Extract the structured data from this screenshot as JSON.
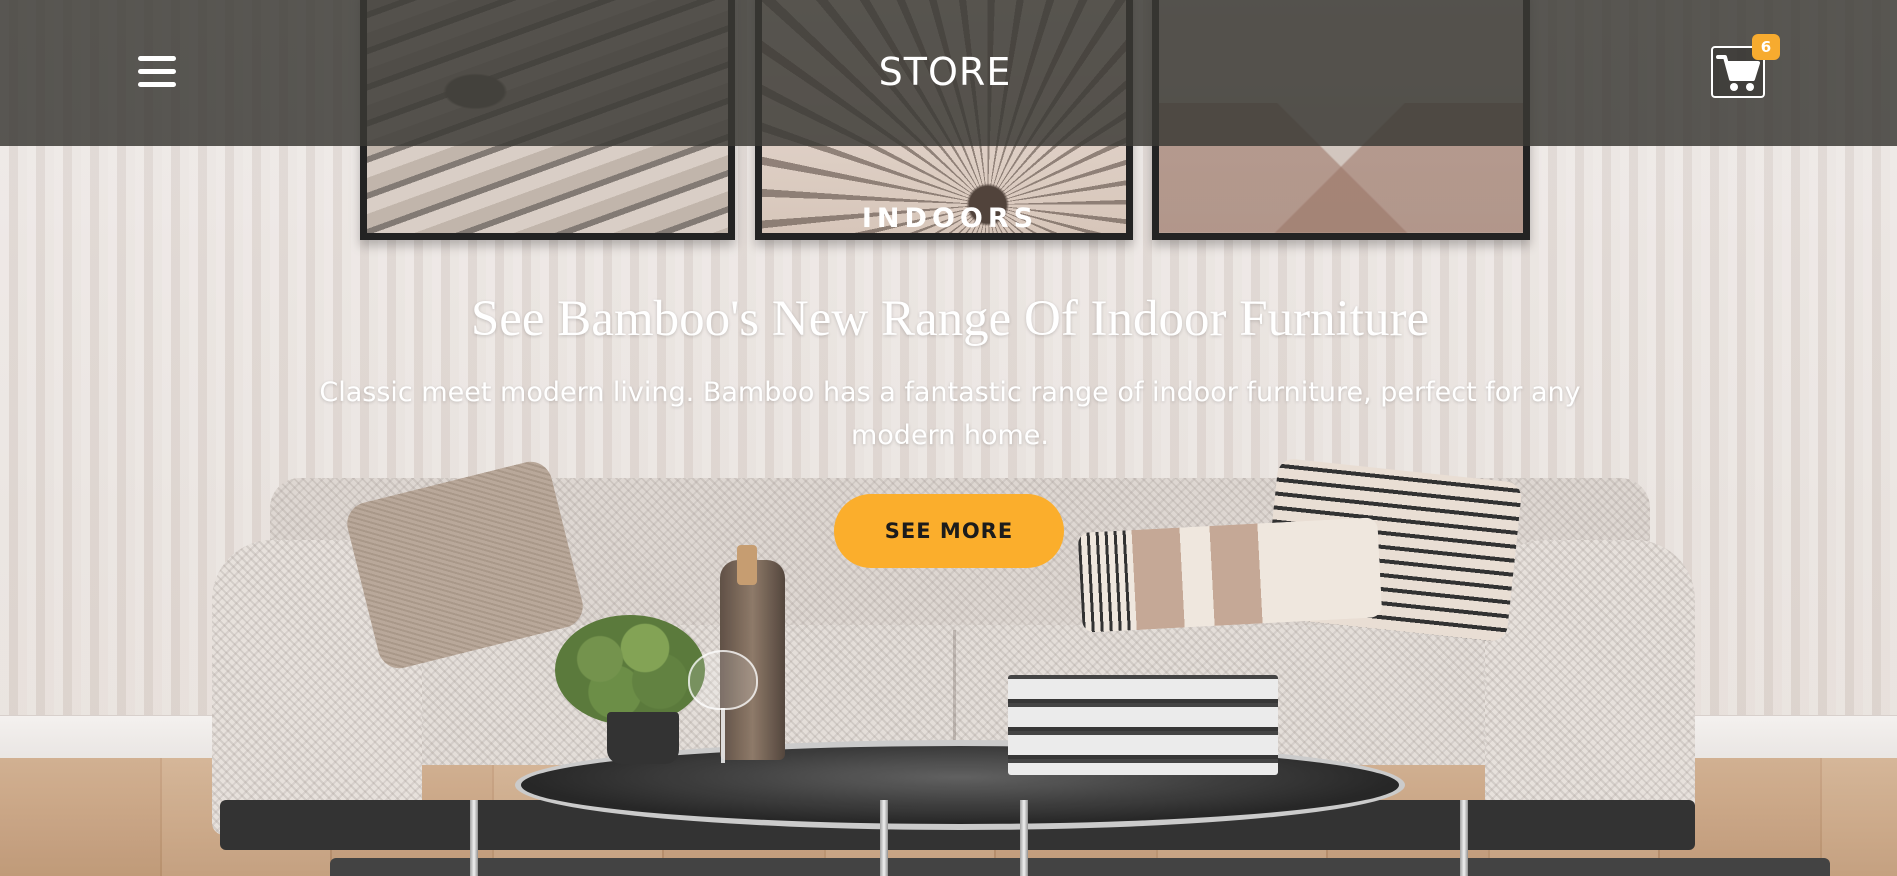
{
  "header": {
    "brand": "STORE",
    "menu_icon": "hamburger-menu-icon",
    "cart_icon": "shopping-cart-icon",
    "cart_count": "6"
  },
  "hero": {
    "eyebrow": "INDOORS",
    "headline": "See Bamboo's New Range Of Indoor Furniture",
    "subtext": "Classic meet modern living. Bamboo has a fantastic range of indoor furniture, perfect for any modern home.",
    "cta_label": "SEE MORE",
    "background_image": "living-room-sofa-photo"
  },
  "colors": {
    "header_bg": "#3a3935",
    "accent": "#fbae2c",
    "text": "#ffffff"
  }
}
